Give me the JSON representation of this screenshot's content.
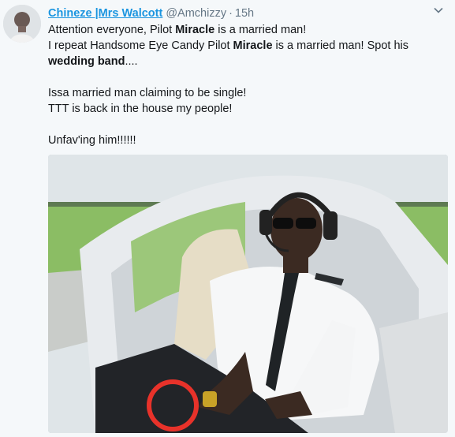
{
  "tweet": {
    "author_name": "Chineze |Mrs Walcott",
    "author_handle": "@Amchizzy",
    "separator": "·",
    "timestamp": "15h",
    "lines": [
      [
        {
          "text": "Attention everyone, Pilot "
        },
        {
          "text": "Miracle",
          "bold": true
        },
        {
          "text": " is a married man!"
        }
      ],
      [
        {
          "text": "I repeat Handsome Eye Candy Pilot "
        },
        {
          "text": "Miracle",
          "bold": true
        },
        {
          "text": " is a married man! Spot his "
        },
        {
          "text": "wedding band",
          "bold": true
        },
        {
          "text": "...."
        }
      ],
      [],
      [
        {
          "text": "Issa married man claiming to be single!"
        }
      ],
      [
        {
          "text": "TTT is back in the house my people!"
        }
      ],
      [],
      [
        {
          "text": "Unfav'ing him!!!!!!"
        }
      ]
    ]
  },
  "icons": {
    "menu": "chevron-down-icon",
    "avatar": "user-avatar"
  },
  "colors": {
    "name_link": "#1b95e0",
    "muted": "#657786",
    "annotation_circle": "#e8322a"
  }
}
